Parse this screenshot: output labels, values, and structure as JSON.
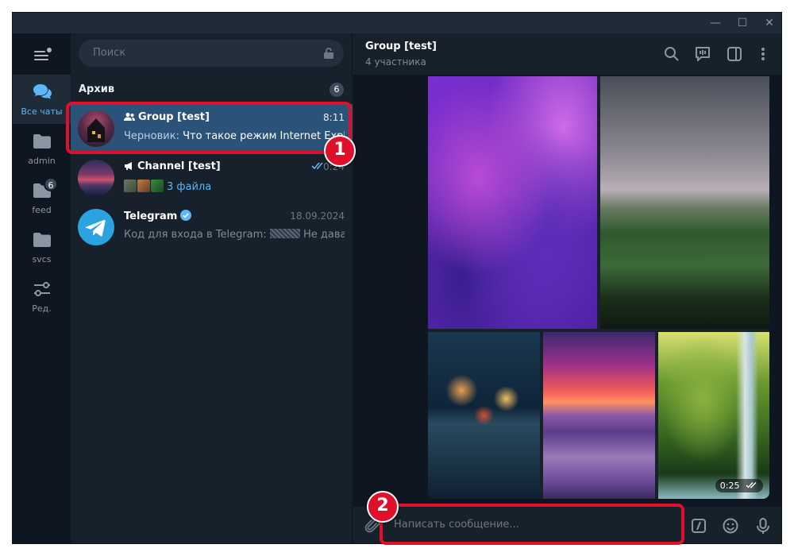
{
  "window": {
    "controls": [
      "—",
      "☐",
      "✕"
    ]
  },
  "search": {
    "placeholder": "Поиск"
  },
  "folders": [
    {
      "label": "Все чаты",
      "icon": "chats-icon",
      "active": true
    },
    {
      "label": "admin",
      "icon": "folder-icon"
    },
    {
      "label": "feed",
      "icon": "folder-icon",
      "badge": "6"
    },
    {
      "label": "svcs",
      "icon": "folder-icon"
    },
    {
      "label": "Ред.",
      "icon": "edit-folders-icon"
    }
  ],
  "archive": {
    "title": "Архив",
    "count": "6"
  },
  "chats": [
    {
      "name": "Group [test]",
      "time": "8:11",
      "draft_label": "Черновик:",
      "preview": "Что такое режим Internet Explorer",
      "selected": true
    },
    {
      "name": "Channel [test]",
      "time": "0:24",
      "preview": "3 файла"
    },
    {
      "name": "Telegram",
      "time": "18.09.2024",
      "preview_start": "Код для входа в Telegram:",
      "preview_end": "Не давайте..."
    }
  ],
  "conversation": {
    "title": "Group [test]",
    "subtitle": "4 участника",
    "video_duration": "0:25",
    "composer_placeholder": "Написать сообщение..."
  },
  "annotations": {
    "marker_1": "1",
    "marker_2": "2"
  },
  "colors": {
    "accent": "#5eb5f7",
    "selection": "#2b5278",
    "annotation": "#e0102a"
  }
}
